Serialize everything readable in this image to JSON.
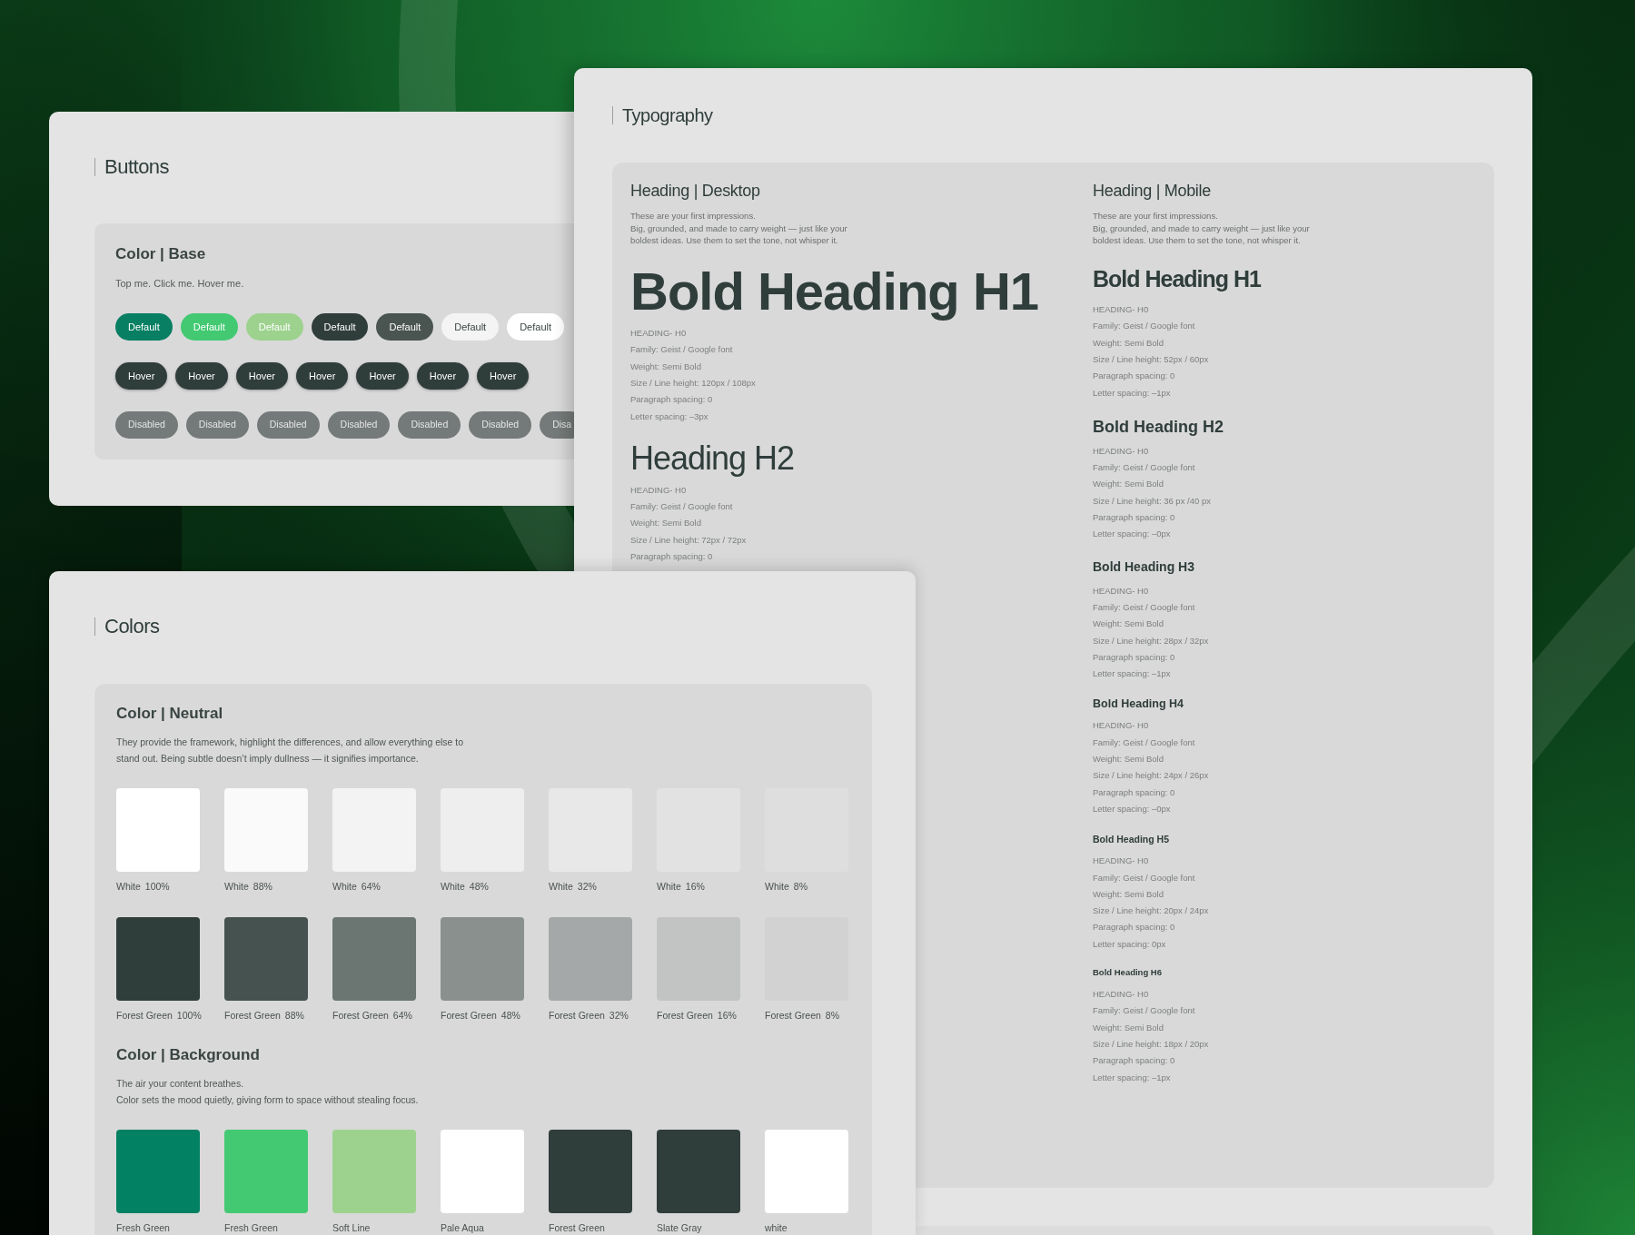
{
  "buttons_panel": {
    "title": "Buttons",
    "section": {
      "heading": "Color | Base",
      "description": "Top me. Click me. Hover me.",
      "rows": [
        {
          "kind": "default",
          "buttons": [
            {
              "label": "Default",
              "color": "#087f62"
            },
            {
              "label": "Default",
              "color": "#42c972"
            },
            {
              "label": "Default",
              "color": "#9dd28e"
            },
            {
              "label": "Default",
              "color": "#2f3d3b"
            },
            {
              "label": "Default",
              "color": "#4a5451"
            },
            {
              "label": "Default",
              "color": "#f4f4f4"
            },
            {
              "label": "Default",
              "color": "#ffffff"
            }
          ]
        },
        {
          "kind": "hover",
          "buttons": [
            {
              "label": "Hover",
              "color": "#2f3d3b"
            },
            {
              "label": "Hover",
              "color": "#2f3d3b"
            },
            {
              "label": "Hover",
              "color": "#2f3d3b"
            },
            {
              "label": "Hover",
              "color": "#2f3d3b"
            },
            {
              "label": "Hover",
              "color": "#2f3d3b"
            },
            {
              "label": "Hover",
              "color": "#2f3d3b"
            },
            {
              "label": "Hover",
              "color": "#2f3d3b"
            }
          ]
        },
        {
          "kind": "disabled",
          "buttons": [
            {
              "label": "Disabled",
              "color": "#747a79"
            },
            {
              "label": "Disabled",
              "color": "#747a79"
            },
            {
              "label": "Disabled",
              "color": "#747a79"
            },
            {
              "label": "Disabled",
              "color": "#747a79"
            },
            {
              "label": "Disabled",
              "color": "#747a79"
            },
            {
              "label": "Disabled",
              "color": "#747a79"
            },
            {
              "label": "Disa",
              "color": "#747a79"
            }
          ]
        }
      ]
    }
  },
  "typography_panel": {
    "title": "Typography",
    "columns": [
      {
        "kind": "desktop",
        "heading": "Heading | Desktop",
        "description": [
          "These are your first impressions.",
          "Big, grounded, and made to carry weight — just like your",
          "boldest ideas. Use them to set the tone, not whisper it."
        ],
        "styles": [
          {
            "kind": "h1",
            "sample": "Bold Heading H1",
            "specs": [
              "HEADING- H0",
              "Family: Geist / Google font",
              "Weight: Semi Bold",
              "Size / Line height: 120px / 108px",
              "Paragraph spacing: 0",
              "Letter spacing: –3px"
            ]
          },
          {
            "kind": "h2",
            "sample": "Heading H2",
            "specs": [
              "HEADING- H0",
              "Family: Geist / Google font",
              "Weight: Semi Bold",
              "Size / Line height: 72px / 72px",
              "Paragraph spacing: 0"
            ]
          }
        ]
      },
      {
        "kind": "mobile",
        "heading": "Heading | Mobile",
        "description": [
          "These are your first impressions.",
          "Big, grounded, and made to carry weight — just like your",
          "boldest ideas. Use them to set the tone, not whisper it."
        ],
        "styles": [
          {
            "kind": "h1",
            "sample": "Bold Heading H1",
            "specs": [
              "HEADING- H0",
              "Family: Geist / Google font",
              "Weight: Semi Bold",
              "Size / Line height: 52px / 60px",
              "Paragraph spacing: 0",
              "Letter spacing: –1px"
            ]
          },
          {
            "kind": "h2",
            "sample": "Bold Heading H2",
            "specs": [
              "HEADING- H0",
              "Family: Geist / Google font",
              "Weight: Semi Bold",
              "Size / Line height: 36 px /40 px",
              "Paragraph spacing: 0",
              "Letter spacing: –0px"
            ]
          },
          {
            "kind": "h3",
            "sample": "Bold Heading H3",
            "specs": [
              "HEADING- H0",
              "Family: Geist / Google font",
              "Weight: Semi Bold",
              "Size / Line height: 28px / 32px",
              "Paragraph spacing: 0",
              "Letter spacing: –1px"
            ]
          },
          {
            "kind": "h4",
            "sample": "Bold Heading H4",
            "specs": [
              "HEADING- H0",
              "Family: Geist / Google font",
              "Weight: Semi Bold",
              "Size / Line height: 24px / 26px",
              "Paragraph spacing: 0",
              "Letter spacing: –0px"
            ]
          },
          {
            "kind": "h5",
            "sample": "Bold Heading H5",
            "specs": [
              "HEADING- H0",
              "Family: Geist / Google font",
              "Weight: Semi Bold",
              "Size / Line height: 20px / 24px",
              "Paragraph spacing: 0",
              "Letter spacing: 0px"
            ]
          },
          {
            "kind": "h6",
            "sample": "Bold Heading H6",
            "specs": [
              "HEADING- H0",
              "Family: Geist / Google font",
              "Weight: Semi Bold",
              "Size / Line height: 18px / 20px",
              "Paragraph spacing: 0",
              "Letter spacing: –1px"
            ]
          }
        ]
      }
    ]
  },
  "colors_panel": {
    "title": "Colors",
    "sections": [
      {
        "heading": "Color | Neutral",
        "description": [
          "They provide the framework, highlight the differences, and allow everything else to",
          "stand out. Being subtle doesn’t imply dullness — it signifies importance."
        ],
        "swatches": [
          {
            "name": "White",
            "share": "100%",
            "color": "#ffffff"
          },
          {
            "name": "White",
            "share": "88%",
            "color": "#fafafa"
          },
          {
            "name": "White",
            "share": "64%",
            "color": "#f3f3f3"
          },
          {
            "name": "White",
            "share": "48%",
            "color": "#eeeeee"
          },
          {
            "name": "White",
            "share": "32%",
            "color": "#e8e8e8"
          },
          {
            "name": "White",
            "share": "16%",
            "color": "#e2e2e2"
          },
          {
            "name": "White",
            "share": "8%",
            "color": "#dedede"
          },
          {
            "name": "Forest Green",
            "share": "100%",
            "color": "#2f3d3b"
          },
          {
            "name": "Forest Green",
            "share": "88%",
            "color": "#45524f"
          },
          {
            "name": "Forest Green",
            "share": "64%",
            "color": "#6b7673"
          },
          {
            "name": "Forest Green",
            "share": "48%",
            "color": "#8a908e"
          },
          {
            "name": "Forest Green",
            "share": "32%",
            "color": "#a4a8a8"
          },
          {
            "name": "Forest Green",
            "share": "16%",
            "color": "#c2c4c3"
          },
          {
            "name": "Forest Green",
            "share": "8%",
            "color": "#d2d2d2"
          }
        ]
      },
      {
        "heading": "Color | Background",
        "description": [
          "The air your content breathes.",
          "Color sets the mood quietly, giving form to space without stealing focus."
        ],
        "swatches": [
          {
            "name": "Fresh Green",
            "color": "#028263"
          },
          {
            "name": "Fresh Green",
            "color": "#42c972"
          },
          {
            "name": "Soft Line",
            "color": "#9dd28e"
          },
          {
            "name": "Pale Aqua",
            "color": "#ffffff"
          },
          {
            "name": "Forest Green",
            "color": "#2f3d3b"
          },
          {
            "name": "Slate Gray",
            "color": "#2f3d3b"
          },
          {
            "name": "white",
            "color": "#ffffff"
          }
        ]
      }
    ]
  }
}
